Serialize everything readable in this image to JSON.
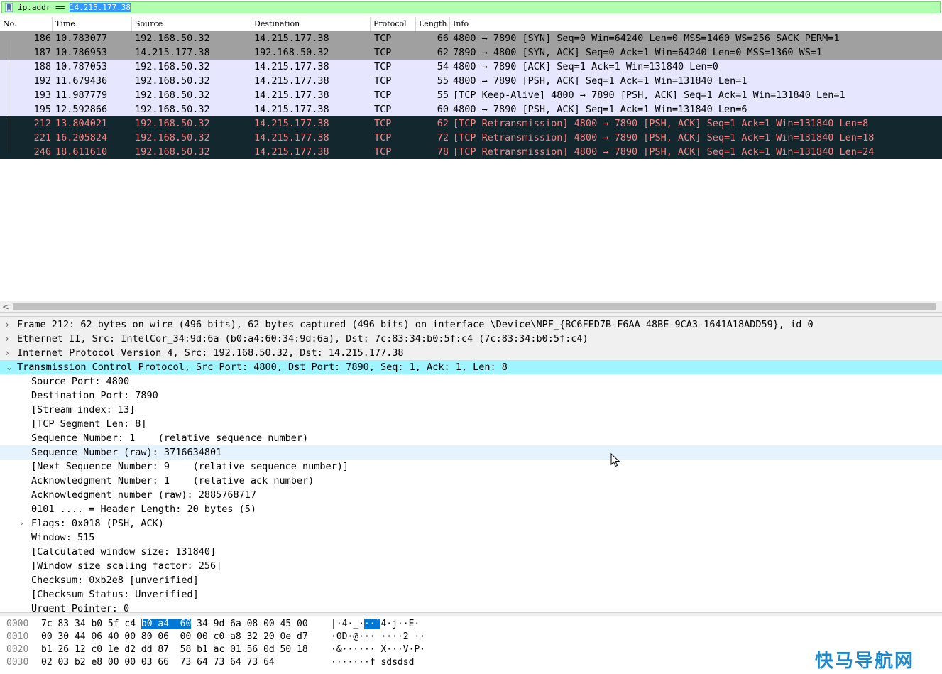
{
  "filter": {
    "prefix": "ip.addr == ",
    "selected": "14.215.177.38"
  },
  "columns": [
    "No.",
    "Time",
    "Source",
    "Destination",
    "Protocol",
    "Length",
    "Info"
  ],
  "packets": [
    {
      "no": "186",
      "time": "10.783077",
      "src": "192.168.50.32",
      "dst": "14.215.177.38",
      "proto": "TCP",
      "len": "66",
      "info": "4800 → 7890 [SYN] Seq=0 Win=64240 Len=0 MSS=1460 WS=256 SACK_PERM=1",
      "style": "gray"
    },
    {
      "no": "187",
      "time": "10.786953",
      "src": "14.215.177.38",
      "dst": "192.168.50.32",
      "proto": "TCP",
      "len": "62",
      "info": "7890 → 4800 [SYN, ACK] Seq=0 Ack=1 Win=64240 Len=0 MSS=1360 WS=1",
      "style": "gray"
    },
    {
      "no": "188",
      "time": "10.787053",
      "src": "192.168.50.32",
      "dst": "14.215.177.38",
      "proto": "TCP",
      "len": "54",
      "info": "4800 → 7890 [ACK] Seq=1 Ack=1 Win=131840 Len=0",
      "style": "lav"
    },
    {
      "no": "192",
      "time": "11.679436",
      "src": "192.168.50.32",
      "dst": "14.215.177.38",
      "proto": "TCP",
      "len": "55",
      "info": "4800 → 7890 [PSH, ACK] Seq=1 Ack=1 Win=131840 Len=1",
      "style": "lav"
    },
    {
      "no": "193",
      "time": "11.987779",
      "src": "192.168.50.32",
      "dst": "14.215.177.38",
      "proto": "TCP",
      "len": "55",
      "info": "[TCP Keep-Alive] 4800 → 7890 [PSH, ACK] Seq=1 Ack=1 Win=131840 Len=1",
      "style": "lav"
    },
    {
      "no": "195",
      "time": "12.592866",
      "src": "192.168.50.32",
      "dst": "14.215.177.38",
      "proto": "TCP",
      "len": "60",
      "info": "4800 → 7890 [PSH, ACK] Seq=1 Ack=1 Win=131840 Len=6",
      "style": "lav"
    },
    {
      "no": "212",
      "time": "13.804021",
      "src": "192.168.50.32",
      "dst": "14.215.177.38",
      "proto": "TCP",
      "len": "62",
      "info": "[TCP Retransmission] 4800 → 7890 [PSH, ACK] Seq=1 Ack=1 Win=131840 Len=8",
      "style": "dark"
    },
    {
      "no": "221",
      "time": "16.205824",
      "src": "192.168.50.32",
      "dst": "14.215.177.38",
      "proto": "TCP",
      "len": "72",
      "info": "[TCP Retransmission] 4800 → 7890 [PSH, ACK] Seq=1 Ack=1 Win=131840 Len=18",
      "style": "dark"
    },
    {
      "no": "246",
      "time": "18.611610",
      "src": "192.168.50.32",
      "dst": "14.215.177.38",
      "proto": "TCP",
      "len": "78",
      "info": "[TCP Retransmission] 4800 → 7890 [PSH, ACK] Seq=1 Ack=1 Win=131840 Len=24",
      "style": "dark"
    }
  ],
  "details": [
    {
      "text": "Frame 212: 62 bytes on wire (496 bits), 62 bytes captured (496 bits) on interface \\Device\\NPF_{BC6FED7B-F6AA-48BE-9CA3-1641A18ADD59}, id 0",
      "level": 0,
      "arrow": "›",
      "style": "top"
    },
    {
      "text": "Ethernet II, Src: IntelCor_34:9d:6a (b0:a4:60:34:9d:6a), Dst: 7c:83:34:b0:5f:c4 (7c:83:34:b0:5f:c4)",
      "level": 0,
      "arrow": "›",
      "style": "top"
    },
    {
      "text": "Internet Protocol Version 4, Src: 192.168.50.32, Dst: 14.215.177.38",
      "level": 0,
      "arrow": "›",
      "style": "top"
    },
    {
      "text": "Transmission Control Protocol, Src Port: 4800, Dst Port: 7890, Seq: 1, Ack: 1, Len: 8",
      "level": 0,
      "arrow": "⌄",
      "style": "sel"
    },
    {
      "text": "Source Port: 4800",
      "level": 1,
      "arrow": "",
      "style": ""
    },
    {
      "text": "Destination Port: 7890",
      "level": 1,
      "arrow": "",
      "style": ""
    },
    {
      "text": "[Stream index: 13]",
      "level": 1,
      "arrow": "",
      "style": ""
    },
    {
      "text": "[TCP Segment Len: 8]",
      "level": 1,
      "arrow": "",
      "style": ""
    },
    {
      "text": "Sequence Number: 1    (relative sequence number)",
      "level": 1,
      "arrow": "",
      "style": ""
    },
    {
      "text": "Sequence Number (raw): 3716634801",
      "level": 1,
      "arrow": "",
      "style": "hover"
    },
    {
      "text": "[Next Sequence Number: 9    (relative sequence number)]",
      "level": 1,
      "arrow": "",
      "style": ""
    },
    {
      "text": "Acknowledgment Number: 1    (relative ack number)",
      "level": 1,
      "arrow": "",
      "style": ""
    },
    {
      "text": "Acknowledgment number (raw): 2885768717",
      "level": 1,
      "arrow": "",
      "style": ""
    },
    {
      "text": "0101 .... = Header Length: 20 bytes (5)",
      "level": 1,
      "arrow": "",
      "style": ""
    },
    {
      "text": "Flags: 0x018 (PSH, ACK)",
      "level": 1,
      "arrow": "›",
      "style": ""
    },
    {
      "text": "Window: 515",
      "level": 1,
      "arrow": "",
      "style": ""
    },
    {
      "text": "[Calculated window size: 131840]",
      "level": 1,
      "arrow": "",
      "style": ""
    },
    {
      "text": "[Window size scaling factor: 256]",
      "level": 1,
      "arrow": "",
      "style": ""
    },
    {
      "text": "Checksum: 0xb2e8 [unverified]",
      "level": 1,
      "arrow": "",
      "style": ""
    },
    {
      "text": "[Checksum Status: Unverified]",
      "level": 1,
      "arrow": "",
      "style": ""
    },
    {
      "text": "Urgent Pointer: 0",
      "level": 1,
      "arrow": "",
      "style": ""
    }
  ],
  "hex": [
    {
      "off": "0000",
      "b1": "7c 83 34 b0 5f c4 ",
      "bh": "b0 a4  60",
      "b2": " 34 9d 6a 08 00 45 00",
      "a1": "|·4·_·",
      "ah": "··`",
      "a2": "4·j··E·"
    },
    {
      "off": "0010",
      "b1": "00 30 44 06 40 00 80 06  00 00 c0 a8 32 20 0e d7",
      "bh": "",
      "b2": "",
      "a1": "·0D·@··· ····2 ··",
      "ah": "",
      "a2": ""
    },
    {
      "off": "0020",
      "b1": "b1 26 12 c0 1e d2 dd 87  58 b1 ac 01 56 0d 50 18",
      "bh": "",
      "b2": "",
      "a1": "·&······ X···V·P·",
      "ah": "",
      "a2": ""
    },
    {
      "off": "0030",
      "b1": "02 03 b2 e8 00 00 03 66  73 64 73 64 73 64",
      "bh": "",
      "b2": "",
      "a1": "·······f sdsdsd",
      "ah": "",
      "a2": ""
    }
  ],
  "watermark": "快马导航网"
}
